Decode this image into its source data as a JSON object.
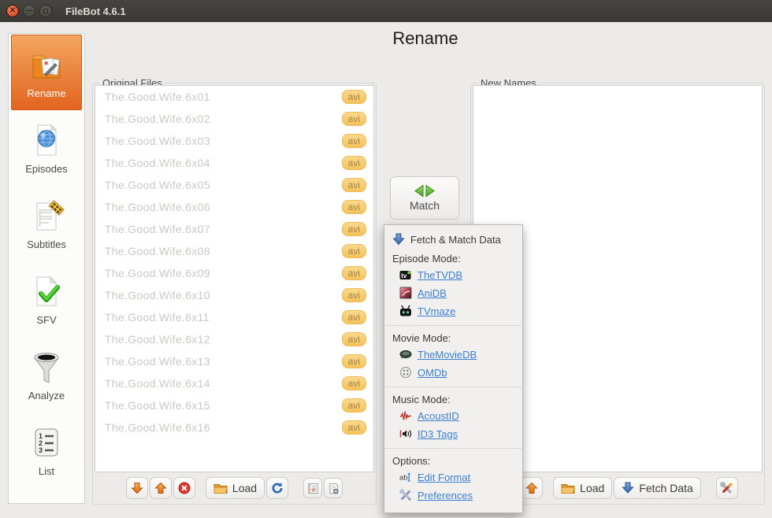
{
  "window": {
    "title": "FileBot 4.6.1"
  },
  "page": {
    "title": "Rename"
  },
  "sidebar": {
    "items": [
      {
        "label": "Rename",
        "icon": "rename-folder-icon",
        "selected": true
      },
      {
        "label": "Episodes",
        "icon": "episodes-globe-icon",
        "selected": false
      },
      {
        "label": "Subtitles",
        "icon": "subtitles-document-icon",
        "selected": false
      },
      {
        "label": "SFV",
        "icon": "sfv-checkmark-icon",
        "selected": false
      },
      {
        "label": "Analyze",
        "icon": "analyze-funnel-icon",
        "selected": false
      },
      {
        "label": "List",
        "icon": "list-numbered-icon",
        "selected": false
      }
    ]
  },
  "original_files": {
    "title": "Original Files",
    "files": [
      {
        "name": "The.Good.Wife.6x01",
        "ext": "avi"
      },
      {
        "name": "The.Good.Wife.6x02",
        "ext": "avi"
      },
      {
        "name": "The.Good.Wife.6x03",
        "ext": "avi"
      },
      {
        "name": "The.Good.Wife.6x04",
        "ext": "avi"
      },
      {
        "name": "The.Good.Wife.6x05",
        "ext": "avi"
      },
      {
        "name": "The.Good.Wife.6x06",
        "ext": "avi"
      },
      {
        "name": "The.Good.Wife.6x07",
        "ext": "avi"
      },
      {
        "name": "The.Good.Wife.6x08",
        "ext": "avi"
      },
      {
        "name": "The.Good.Wife.6x09",
        "ext": "avi"
      },
      {
        "name": "The.Good.Wife.6x10",
        "ext": "avi"
      },
      {
        "name": "The.Good.Wife.6x11",
        "ext": "avi"
      },
      {
        "name": "The.Good.Wife.6x12",
        "ext": "avi"
      },
      {
        "name": "The.Good.Wife.6x13",
        "ext": "avi"
      },
      {
        "name": "The.Good.Wife.6x14",
        "ext": "avi"
      },
      {
        "name": "The.Good.Wife.6x15",
        "ext": "avi"
      },
      {
        "name": "The.Good.Wife.6x16",
        "ext": "avi"
      }
    ]
  },
  "new_names": {
    "title": "New Names",
    "files": []
  },
  "match": {
    "label": "Match"
  },
  "menu": {
    "header": "Fetch & Match Data",
    "sections": [
      {
        "label": "Episode Mode:",
        "items": [
          {
            "label": "TheTVDB",
            "icon": "thetvdb-icon"
          },
          {
            "label": "AniDB",
            "icon": "anidb-icon"
          },
          {
            "label": "TVmaze",
            "icon": "tvmaze-icon"
          }
        ]
      },
      {
        "label": "Movie Mode:",
        "items": [
          {
            "label": "TheMovieDB",
            "icon": "themoviedb-icon"
          },
          {
            "label": "OMDb",
            "icon": "omdb-icon"
          }
        ]
      },
      {
        "label": "Music Mode:",
        "items": [
          {
            "label": "AcoustID",
            "icon": "acoustid-waveform-icon"
          },
          {
            "label": "ID3 Tags",
            "icon": "id3-speaker-icon"
          }
        ]
      },
      {
        "label": "Options:",
        "items": [
          {
            "label": "Edit Format",
            "icon": "edit-format-icon"
          },
          {
            "label": "Preferences",
            "icon": "preferences-tools-icon"
          }
        ]
      }
    ]
  },
  "toolbar_left": {
    "load": "Load"
  },
  "toolbar_right": {
    "load": "Load",
    "fetch": "Fetch Data"
  },
  "colors": {
    "accent_orange": "#e2641f",
    "link_blue": "#3b7fd4",
    "badge_bg": "#f8cb6d",
    "titlebar_bg": "#3c3a36",
    "menu_bg": "#f1f0ee"
  }
}
